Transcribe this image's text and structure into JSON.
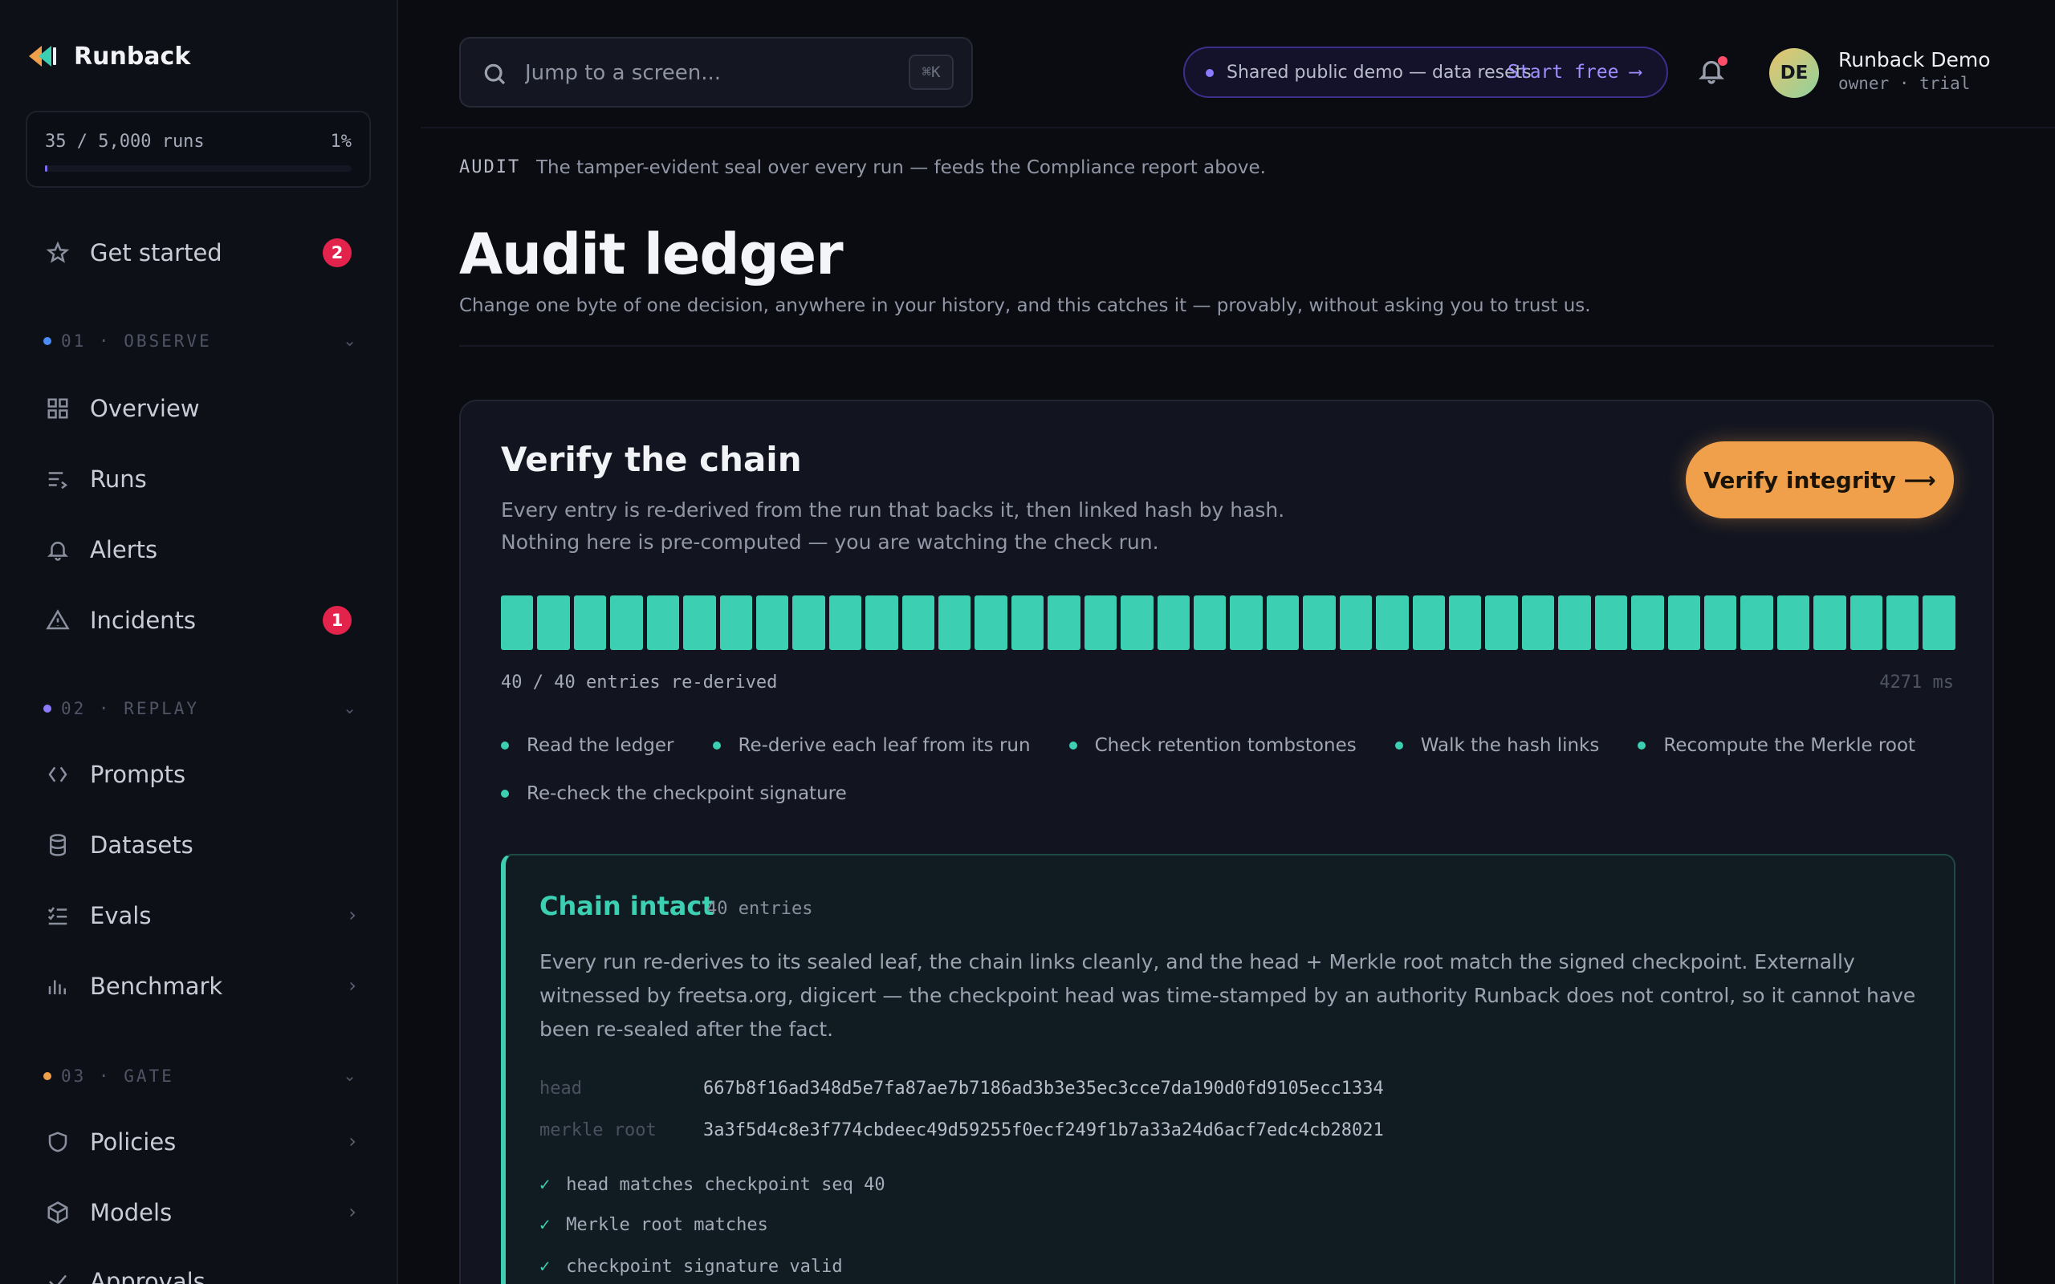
{
  "sidebar": {
    "brand": "Runback",
    "usage": {
      "text": "35 / 5,000 runs",
      "percent_label": "1%",
      "fraction": 0.007
    },
    "items": [
      {
        "label": "Get started",
        "badge": "2"
      },
      {
        "label": "Overview"
      },
      {
        "label": "Runs"
      },
      {
        "label": "Alerts"
      },
      {
        "label": "Incidents",
        "badge": "1"
      },
      {
        "label": "Prompts"
      },
      {
        "label": "Datasets"
      },
      {
        "label": "Evals"
      },
      {
        "label": "Benchmark"
      },
      {
        "label": "Policies"
      },
      {
        "label": "Models"
      },
      {
        "label": "Approvals"
      }
    ],
    "sections": [
      {
        "label": "01 · OBSERVE",
        "color": "#4b8cf7"
      },
      {
        "label": "02 · REPLAY",
        "color": "#8b7bff"
      },
      {
        "label": "03 · GATE",
        "color": "#f0a04b"
      }
    ]
  },
  "topbar": {
    "search_placeholder": "Jump to a screen...",
    "search_shortcut": "⌘K",
    "demo_text": "Shared public demo — data resets",
    "demo_link": "Start free ⟶",
    "user_initials": "DE",
    "user_name": "Runback Demo",
    "user_role": "owner · trial"
  },
  "page": {
    "eyebrow_label": "AUDIT",
    "eyebrow_text": "The tamper-evident seal over every run — feeds the Compliance report above.",
    "title": "Audit ledger",
    "subtitle": "Change one byte of one decision, anywhere in your history, and this catches it — provably, without asking you to trust us."
  },
  "card": {
    "title": "Verify the chain",
    "desc_line1": "Every entry is re-derived from the run that backs it, then linked hash by hash.",
    "desc_line2": "Nothing here is pre-computed — you are watching the check run.",
    "button": "Verify integrity ⟶",
    "entries_done": 40,
    "entries_total": 40,
    "progress_text": "40 / 40 entries re-derived",
    "duration": "4271 ms",
    "steps": [
      "Read the ledger",
      "Re-derive each leaf from its run",
      "Check retention tombstones",
      "Walk the hash links",
      "Recompute the Merkle root",
      "Re-check the checkpoint signature"
    ],
    "colors": {
      "accent": "#3ccfb1",
      "button": "#f0a04b"
    }
  },
  "result": {
    "title": "Chain intact",
    "count": "40 entries",
    "description": "Every run re-derives to its sealed leaf, the chain links cleanly, and the head + Merkle root match the signed checkpoint. Externally witnessed by freetsa.org, digicert — the checkpoint head was time-stamped by an authority Runback does not control, so it cannot have been re-sealed after the fact.",
    "head_label": "head",
    "head_value": "667b8f16ad348d5e7fa87ae7b7186ad3b3e35ec3cce7da190d0fd9105ecc1334",
    "root_label": "merkle root",
    "root_value": "3a3f5d4c8e3f774cbdeec49d59255f0ecf249f1b7a33a24d6acf7edc4cb28021",
    "checks": [
      "head matches checkpoint seq 40",
      "Merkle root matches",
      "checkpoint signature valid"
    ]
  }
}
